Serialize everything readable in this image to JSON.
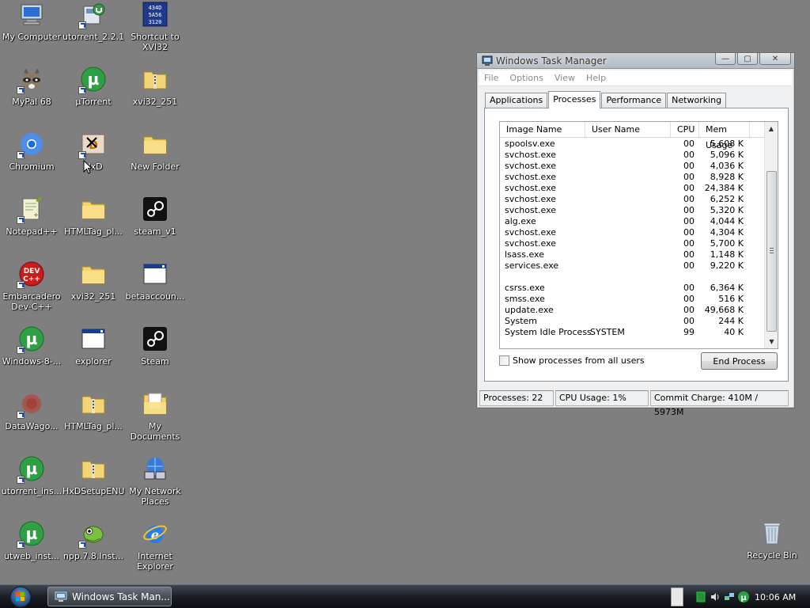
{
  "desktop": {
    "icons": [
      {
        "key": "my-computer",
        "label": "My Computer",
        "icon": "computer-icon"
      },
      {
        "key": "utorrent-221",
        "label": "utorrent_2.2.1",
        "icon": "installer-icon"
      },
      {
        "key": "xvi32-shortcut",
        "label": "Shortcut to\nXVI32",
        "icon": "hex-editor-icon"
      },
      {
        "key": "mypal",
        "label": "MyPal 68",
        "icon": "raccoon-browser-icon"
      },
      {
        "key": "utorrent",
        "label": "µTorrent",
        "icon": "utorrent-icon"
      },
      {
        "key": "xvi32-zip",
        "label": "xvi32_251",
        "icon": "zip-folder-icon"
      },
      {
        "key": "chromium",
        "label": "Chromium",
        "icon": "chromium-icon"
      },
      {
        "key": "hxd",
        "label": "HxD",
        "icon": "hxd-icon"
      },
      {
        "key": "new-folder",
        "label": "New Folder",
        "icon": "folder-icon"
      },
      {
        "key": "notepadpp",
        "label": "Notepad++",
        "icon": "notepadpp-icon"
      },
      {
        "key": "htmltag-folder",
        "label": "HTMLTag_pl...",
        "icon": "folder-icon"
      },
      {
        "key": "steam-v1",
        "label": "steam_v1",
        "icon": "steam-icon"
      },
      {
        "key": "devcpp",
        "label": "Embarcadero\nDev-C++",
        "icon": "devcpp-icon"
      },
      {
        "key": "xvi32-folder",
        "label": "xvi32_251",
        "icon": "folder-icon"
      },
      {
        "key": "betaaccount",
        "label": "betaaccoun...",
        "icon": "window-icon"
      },
      {
        "key": "windows8",
        "label": "Windows-8-...",
        "icon": "utorrent-icon"
      },
      {
        "key": "explorer",
        "label": "explorer",
        "icon": "window-icon"
      },
      {
        "key": "steam",
        "label": "Steam",
        "icon": "steam-icon"
      },
      {
        "key": "datawagon",
        "label": "DataWago...",
        "icon": "datawagon-icon"
      },
      {
        "key": "htmltag-zip",
        "label": "HTMLTag_pl...",
        "icon": "zip-folder-icon"
      },
      {
        "key": "my-documents",
        "label": "My\nDocuments",
        "icon": "documents-folder-icon"
      },
      {
        "key": "utorrent-ins",
        "label": "utorrent_ins...",
        "icon": "utorrent-icon"
      },
      {
        "key": "hxdsetup",
        "label": "HxDSetupENU",
        "icon": "zip-folder-icon"
      },
      {
        "key": "network-places",
        "label": "My Network\nPlaces",
        "icon": "network-icon"
      },
      {
        "key": "utweb",
        "label": "utweb_inst...",
        "icon": "utorrent-icon"
      },
      {
        "key": "npp-inst",
        "label": "npp.7.8.Inst...",
        "icon": "chameleon-icon"
      },
      {
        "key": "ie",
        "label": "Internet\nExplorer",
        "icon": "ie-icon"
      },
      {
        "key": "recycle-bin",
        "label": "Recycle Bin",
        "icon": "recycle-bin-icon"
      }
    ]
  },
  "taskmgr": {
    "title": "Windows Task Manager",
    "menu": [
      "File",
      "Options",
      "View",
      "Help"
    ],
    "tabs": [
      "Applications",
      "Processes",
      "Performance",
      "Networking"
    ],
    "active_tab": "Processes",
    "columns": {
      "name": "Image Name",
      "user": "User Name",
      "cpu": "CPU",
      "mem": "Mem Usage"
    },
    "processes": [
      {
        "name": "spoolsv.exe",
        "user": "",
        "cpu": "00",
        "mem": "5,608 K"
      },
      {
        "name": "svchost.exe",
        "user": "",
        "cpu": "00",
        "mem": "5,096 K"
      },
      {
        "name": "svchost.exe",
        "user": "",
        "cpu": "00",
        "mem": "4,036 K"
      },
      {
        "name": "svchost.exe",
        "user": "",
        "cpu": "00",
        "mem": "8,928 K"
      },
      {
        "name": "svchost.exe",
        "user": "",
        "cpu": "00",
        "mem": "24,384 K"
      },
      {
        "name": "svchost.exe",
        "user": "",
        "cpu": "00",
        "mem": "6,252 K"
      },
      {
        "name": "svchost.exe",
        "user": "",
        "cpu": "00",
        "mem": "5,320 K"
      },
      {
        "name": "alg.exe",
        "user": "",
        "cpu": "00",
        "mem": "4,044 K"
      },
      {
        "name": "svchost.exe",
        "user": "",
        "cpu": "00",
        "mem": "4,304 K"
      },
      {
        "name": "svchost.exe",
        "user": "",
        "cpu": "00",
        "mem": "5,700 K"
      },
      {
        "name": "lsass.exe",
        "user": "",
        "cpu": "00",
        "mem": "1,148 K"
      },
      {
        "name": "services.exe",
        "user": "",
        "cpu": "00",
        "mem": "9,220 K"
      },
      {
        "name": "",
        "user": "",
        "cpu": "",
        "mem": ""
      },
      {
        "name": "csrss.exe",
        "user": "",
        "cpu": "00",
        "mem": "6,364 K"
      },
      {
        "name": "smss.exe",
        "user": "",
        "cpu": "00",
        "mem": "516 K"
      },
      {
        "name": "update.exe",
        "user": "",
        "cpu": "00",
        "mem": "49,668 K"
      },
      {
        "name": "System",
        "user": "",
        "cpu": "00",
        "mem": "244 K"
      },
      {
        "name": "System Idle Process",
        "user": "SYSTEM",
        "cpu": "99",
        "mem": "40 K"
      }
    ],
    "show_all_label": "Show processes from all users",
    "end_process_label": "End Process",
    "status": {
      "processes": "Processes: 22",
      "cpu": "CPU Usage: 1%",
      "commit": "Commit Charge: 410M / 5973M"
    }
  },
  "taskbar": {
    "window_button": "Windows Task Man...",
    "clock": "10:06 AM"
  }
}
